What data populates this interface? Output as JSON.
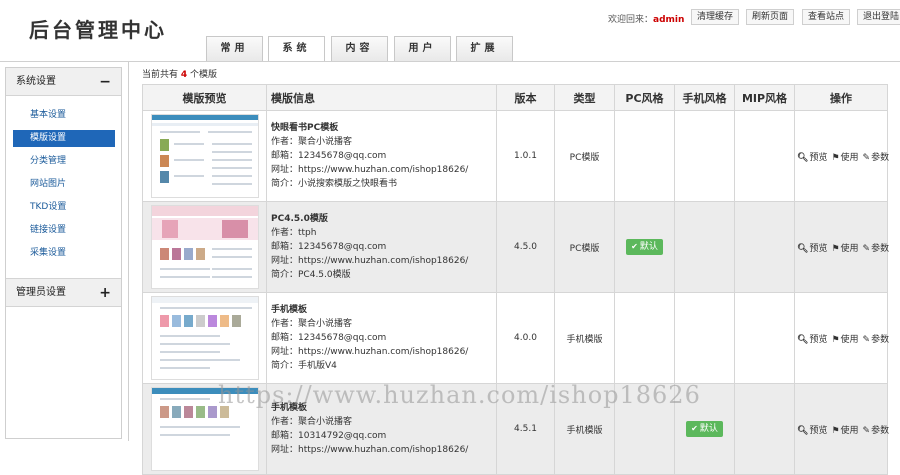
{
  "app": {
    "title": "后台管理中心",
    "welcome_prefix": "欢迎回来：",
    "username": "admin",
    "top_buttons": [
      "清理缓存",
      "刷新页面",
      "查看站点",
      "退出登陆"
    ]
  },
  "tabs": [
    {
      "label": "常用",
      "active": false
    },
    {
      "label": "系统",
      "active": true
    },
    {
      "label": "内容",
      "active": false
    },
    {
      "label": "用户",
      "active": false
    },
    {
      "label": "扩展",
      "active": false
    }
  ],
  "sidebar": {
    "section1_title": "系统设置",
    "section1_sign": "−",
    "items": [
      {
        "label": "基本设置",
        "active": false
      },
      {
        "label": "模版设置",
        "active": true
      },
      {
        "label": "分类管理",
        "active": false
      },
      {
        "label": "网站图片",
        "active": false
      },
      {
        "label": "TKD设置",
        "active": false
      },
      {
        "label": "链接设置",
        "active": false
      },
      {
        "label": "采集设置",
        "active": false
      }
    ],
    "section2_title": "管理员设置",
    "section2_sign": "+"
  },
  "main": {
    "count_prefix": "当前共有",
    "count": "4",
    "count_suffix": "个模版",
    "columns": [
      "模版预览",
      "模版信息",
      "版本",
      "类型",
      "PC风格",
      "手机风格",
      "MIP风格",
      "操作"
    ],
    "rows": [
      {
        "name": "快眼看书PC模板",
        "author": "作者：聚合小说播客",
        "email": "邮箱：12345678@qq.com",
        "url": "网址：https://www.huzhan.com/ishop18626/",
        "intro": "简介：小说搜索模版之快眼看书",
        "version": "1.0.1",
        "type": "PC模版",
        "pc_default": "",
        "mobile_default": "",
        "mip_default": ""
      },
      {
        "name": "PC4.5.0模版",
        "author": "作者：ttph",
        "email": "邮箱：12345678@qq.com",
        "url": "网址：https://www.huzhan.com/ishop18626/",
        "intro": "简介：PC4.5.0模版",
        "version": "4.5.0",
        "type": "PC模版",
        "pc_default": "默认",
        "mobile_default": "",
        "mip_default": ""
      },
      {
        "name": "手机模板",
        "author": "作者：聚合小说播客",
        "email": "邮箱：12345678@qq.com",
        "url": "网址：https://www.huzhan.com/ishop18626/",
        "intro": "简介：手机版V4",
        "version": "4.0.0",
        "type": "手机模版",
        "pc_default": "",
        "mobile_default": "",
        "mip_default": ""
      },
      {
        "name": "手机模板",
        "author": "作者：聚合小说播客",
        "email": "邮箱：10314792@qq.com",
        "url": "网址：https://www.huzhan.com/ishop18626/",
        "intro": "",
        "version": "4.5.1",
        "type": "手机模版",
        "pc_default": "",
        "mobile_default": "默认",
        "mip_default": ""
      }
    ],
    "ops": [
      "预览",
      "使用",
      "参数"
    ],
    "op_icons": [
      "magnifier-icon",
      "flag-icon",
      "edit-icon"
    ]
  },
  "watermark": "https://www.huzhan.com/ishop18626",
  "colors": {
    "accent": "#1f67b8",
    "highlight": "#cc0000",
    "default_badge": "#5cb85c"
  }
}
